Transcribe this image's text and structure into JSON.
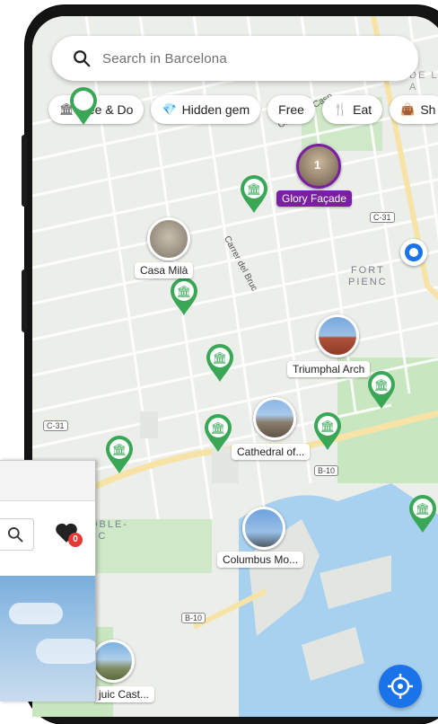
{
  "search": {
    "placeholder": "Search in Barcelona"
  },
  "chips": [
    {
      "label": "See & Do",
      "icon": "museum-icon"
    },
    {
      "label": "Hidden gem",
      "icon": "diamond-icon"
    },
    {
      "label": "Free",
      "icon": ""
    },
    {
      "label": "Eat",
      "icon": "cutlery-icon"
    },
    {
      "label": "Sh",
      "icon": "shopping-icon"
    }
  ],
  "places": {
    "glory": {
      "label": "Glory Façade",
      "count": "1"
    },
    "casa_mila": {
      "label": "Casa Milà"
    },
    "triumphal": {
      "label": "Triumphal Arch"
    },
    "cathedral": {
      "label": "Cathedral of..."
    },
    "columbus": {
      "label": "Columbus Mo..."
    },
    "montjuic": {
      "label": "juic Cast..."
    }
  },
  "map": {
    "districts": {
      "fort_pienc": "FORT\nPIENC",
      "poble": "OBLE-\nEC",
      "dreta": "DE L'A\nA"
    },
    "streets": {
      "bruc": "Carrer del Bruc",
      "casp": "Carrer de Casp"
    },
    "road_tags": {
      "c31_a": "C-31",
      "c31_b": "C-31",
      "b10_a": "B-10",
      "b10_b": "B-10"
    }
  },
  "overlay": {
    "favorites_count": "0"
  },
  "colors": {
    "accent_green": "#3aa757",
    "glory_purple": "#7b1fa2",
    "water": "#a8d1f0",
    "location_blue": "#1a73e8"
  }
}
